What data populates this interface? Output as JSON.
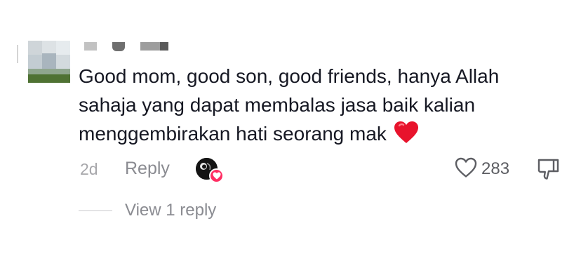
{
  "comment": {
    "text": "Good mom, good son, good friends, hanya Allah sahaja yang dapat membalas jasa baik kalian menggembirakan hati seorang mak",
    "emoji_icon": "red-heart-icon",
    "age": "2d",
    "reply_label": "Reply",
    "likes": "283",
    "view_replies_label": "View 1 reply"
  },
  "colors": {
    "text": "#161823",
    "muted": "#8a8b91",
    "heart_badge": "#ff2e63",
    "emoji_heart": "#e8132c"
  }
}
